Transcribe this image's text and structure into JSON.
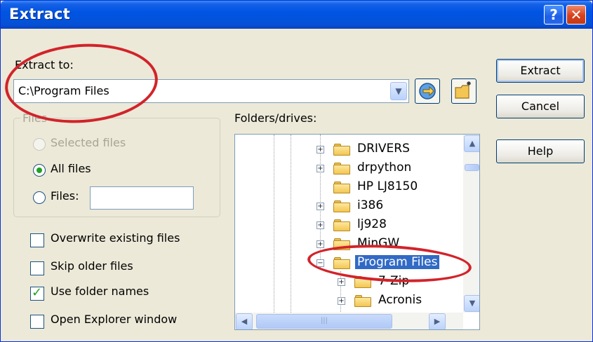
{
  "window": {
    "title": "Extract",
    "help_glyph": "?",
    "close_glyph": "✕"
  },
  "extract_to": {
    "label": "Extract to:",
    "path": "C:\\Program Files"
  },
  "buttons": {
    "extract": "Extract",
    "cancel": "Cancel",
    "help": "Help"
  },
  "files_group": {
    "title": "Files",
    "selected_files": "Selected files",
    "all_files": "All files",
    "files": "Files:",
    "files_value": "",
    "selected": "all_files"
  },
  "options": [
    {
      "label": "Overwrite existing files",
      "checked": false
    },
    {
      "label": "Skip older files",
      "checked": false
    },
    {
      "label": "Use folder names",
      "checked": true
    },
    {
      "label": "Open Explorer window",
      "checked": false
    }
  ],
  "folders": {
    "label": "Folders/drives:",
    "items": [
      {
        "name": "DRIVERS",
        "expander": "+"
      },
      {
        "name": "drpython",
        "expander": "+"
      },
      {
        "name": "HP LJ8150",
        "expander": ""
      },
      {
        "name": "i386",
        "expander": "+"
      },
      {
        "name": "lj928",
        "expander": "+"
      },
      {
        "name": "MinGW",
        "expander": "+"
      },
      {
        "name": "Program Files",
        "expander": "−",
        "selected": true
      },
      {
        "name": "7-Zip",
        "expander": "+"
      },
      {
        "name": "Acronis",
        "expander": "+"
      }
    ]
  },
  "colors": {
    "title_bar": "#0054e3",
    "selection": "#316ac5",
    "annotation": "#d2232a",
    "dialog_bg": "#ece9d8"
  }
}
